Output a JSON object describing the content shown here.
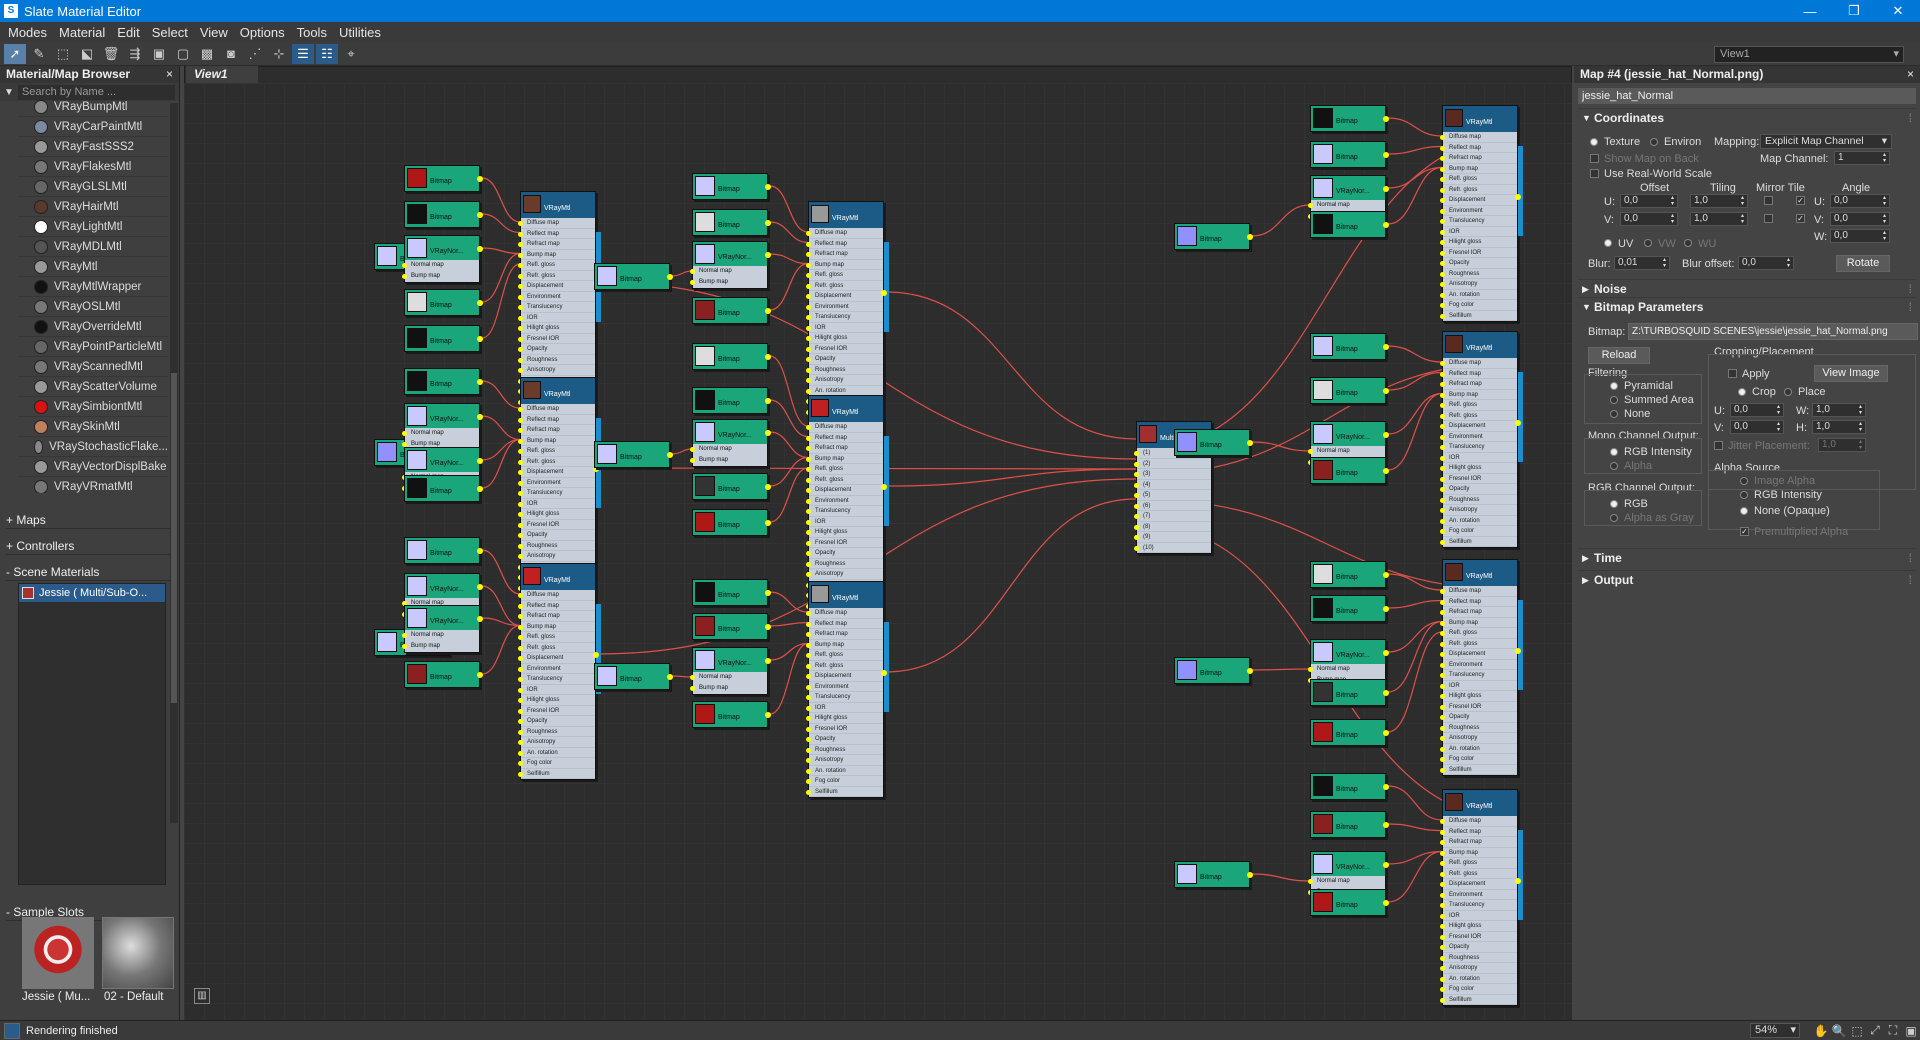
{
  "window": {
    "title": "Slate Material Editor",
    "minimize": "—",
    "maximize": "❐",
    "close": "✕"
  },
  "menu": [
    "Modes",
    "Material",
    "Edit",
    "Select",
    "View",
    "Options",
    "Tools",
    "Utilities"
  ],
  "toolbar": {
    "view_selector": "View1"
  },
  "browser": {
    "title": "Material/Map Browser",
    "search_placeholder": "Search by Name ...",
    "materials": [
      {
        "label": "VRayBumpMtl",
        "color": "#888888"
      },
      {
        "label": "VRayCarPaintMtl",
        "color": "#7a8aa0"
      },
      {
        "label": "VRayFastSSS2",
        "color": "#999999"
      },
      {
        "label": "VRayFlakesMtl",
        "color": "#777777"
      },
      {
        "label": "VRayGLSLMtl",
        "color": "#666666"
      },
      {
        "label": "VRayHairMtl",
        "color": "#5a3a2a"
      },
      {
        "label": "VRayLightMtl",
        "color": "#ffffff"
      },
      {
        "label": "VRayMDLMtl",
        "color": "#555555"
      },
      {
        "label": "VRayMtl",
        "color": "#999999"
      },
      {
        "label": "VRayMtlWrapper",
        "color": "#111111"
      },
      {
        "label": "VRayOSLMtl",
        "color": "#777777"
      },
      {
        "label": "VRayOverrideMtl",
        "color": "#111111"
      },
      {
        "label": "VRayPointParticleMtl",
        "color": "#666666"
      },
      {
        "label": "VRayScannedMtl",
        "color": "#777777"
      },
      {
        "label": "VRayScatterVolume",
        "color": "#999999"
      },
      {
        "label": "VRaySimbiontMtl",
        "color": "#dd1111"
      },
      {
        "label": "VRaySkinMtl",
        "color": "#c08060"
      },
      {
        "label": "VRayStochasticFlake...",
        "color": "#888888"
      },
      {
        "label": "VRayVectorDisplBake",
        "color": "#999999"
      },
      {
        "label": "VRayVRmatMtl",
        "color": "#777777"
      }
    ],
    "sections": {
      "maps": "Maps",
      "controllers": "Controllers",
      "scene_materials": "Scene Materials"
    },
    "scene_material_item": "Jessie ( Multi/Sub-O...",
    "sample_slots_label": "Sample Slots",
    "slots": [
      "Jessie ( Mu...",
      "02 - Default"
    ]
  },
  "view": {
    "tab": "View1"
  },
  "graph": {
    "bitmap_label": "Bitmap",
    "vray_normal_label": "VRayNor...",
    "vray_mtl_label": "VRayMtl",
    "multi_label": "Multi/Sub-...",
    "normal_slot": "Normal map",
    "bump_slot": "Bump map",
    "mtl_slots": [
      "Diffuse map",
      "Reflect map",
      "Refract map",
      "Bump map",
      "Refl. gloss",
      "Refr. gloss",
      "Displacement",
      "Environment",
      "Translucency",
      "IOR",
      "Hilight gloss",
      "Fresnel IOR",
      "Opacity",
      "Roughness",
      "Anisotropy",
      "An. rotation",
      "Fog color",
      "Selfillum"
    ],
    "multi_slots": [
      "(1)",
      "(2)",
      "(3)",
      "(4)",
      "(5)",
      "(6)",
      "(7)",
      "(8)",
      "(9)",
      "(10)"
    ]
  },
  "props": {
    "title": "Map #4 (jessie_hat_Normal.png)",
    "name": "jessie_hat_Normal",
    "coordinates": "Coordinates",
    "texture": "Texture",
    "environ": "Environ",
    "mapping_label": "Mapping:",
    "mapping_value": "Explicit Map Channel",
    "show_map_on_back": "Show Map on Back",
    "map_channel_label": "Map Channel:",
    "map_channel_value": "1",
    "real_world": "Use Real-World Scale",
    "offset": "Offset",
    "tiling": "Tiling",
    "mirror_tile": "Mirror Tile",
    "angle": "Angle",
    "u_label": "U:",
    "v_label": "V:",
    "w_label": "W:",
    "u_offset": "0,0",
    "v_offset": "0,0",
    "u_tiling": "1,0",
    "v_tiling": "1,0",
    "u_angle": "0,0",
    "v_angle": "0,0",
    "w_angle": "0,0",
    "uv": "UV",
    "vw": "VW",
    "wu": "WU",
    "blur_label": "Blur:",
    "blur_value": "0,01",
    "blur_offset_label": "Blur offset:",
    "blur_offset_value": "0,0",
    "rotate": "Rotate",
    "noise": "Noise",
    "bitmap_params": "Bitmap Parameters",
    "bitmap_label": "Bitmap:",
    "bitmap_path": "Z:\\TURBOSQUID SCENES\\jessie\\jessie_hat_Normal.png",
    "reload": "Reload",
    "cropping": "Cropping/Placement",
    "apply": "Apply",
    "view_image": "View Image",
    "crop": "Crop",
    "place": "Place",
    "crop_u": "0,0",
    "crop_v": "0,0",
    "crop_w": "1,0",
    "crop_h": "1,0",
    "h_label": "H:",
    "jitter": "Jitter Placement:",
    "jitter_value": "1,0",
    "filtering": "Filtering",
    "pyramidal": "Pyramidal",
    "summed_area": "Summed Area",
    "none": "None",
    "mono_output": "Mono Channel Output:",
    "rgb_intensity": "RGB Intensity",
    "alpha": "Alpha",
    "rgb_output": "RGB Channel Output:",
    "rgb": "RGB",
    "alpha_as_gray": "Alpha as Gray",
    "alpha_source": "Alpha Source",
    "image_alpha": "Image Alpha",
    "alpha_rgb_intensity": "RGB Intensity",
    "none_opaque": "None (Opaque)",
    "premultiplied": "Premultiplied Alpha",
    "time": "Time",
    "output": "Output"
  },
  "status": {
    "text": "Rendering finished",
    "zoom": "54%"
  }
}
